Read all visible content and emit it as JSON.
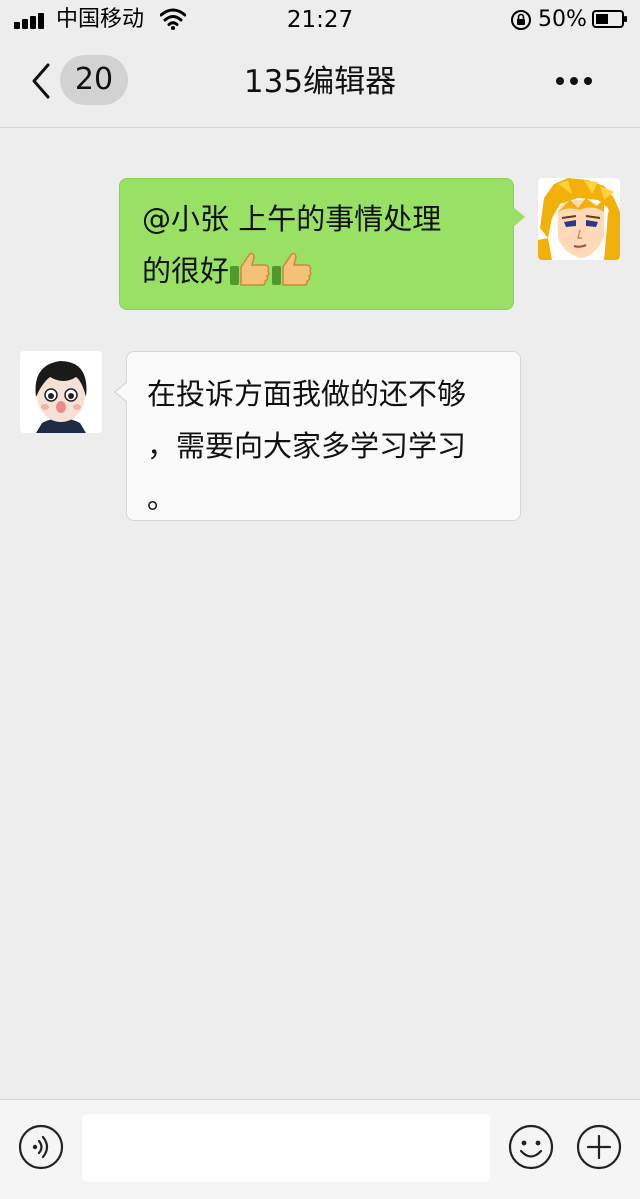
{
  "status_bar": {
    "carrier": "中国移动",
    "time": "21:27",
    "battery_percent": "50%",
    "battery_level": 0.5,
    "icons": [
      "signal-icon",
      "wifi-icon",
      "orientation-lock-icon",
      "battery-icon"
    ]
  },
  "nav": {
    "unread_count": "20",
    "title": "135编辑器",
    "icons": [
      "back-chevron-icon",
      "more-dots-icon"
    ]
  },
  "messages": [
    {
      "direction": "sent",
      "avatar": "anime-character-avatar",
      "lines": [
        "@小张 上午的事情处理",
        "的很好"
      ],
      "emoji": [
        "thumbs-up",
        "thumbs-up"
      ]
    },
    {
      "direction": "received",
      "avatar": "cartoon-boy-avatar",
      "lines": [
        "在投诉方面我做的还不够",
        "，需要向大家多学习学习",
        "。"
      ]
    }
  ],
  "input_bar": {
    "placeholder": "",
    "icons": [
      "voice-icon",
      "emoji-icon",
      "plus-icon"
    ]
  },
  "colors": {
    "background": "#ededed",
    "sent_bubble": "#98e165",
    "received_bubble": "#fafafa",
    "badge": "#d2d2d2"
  }
}
